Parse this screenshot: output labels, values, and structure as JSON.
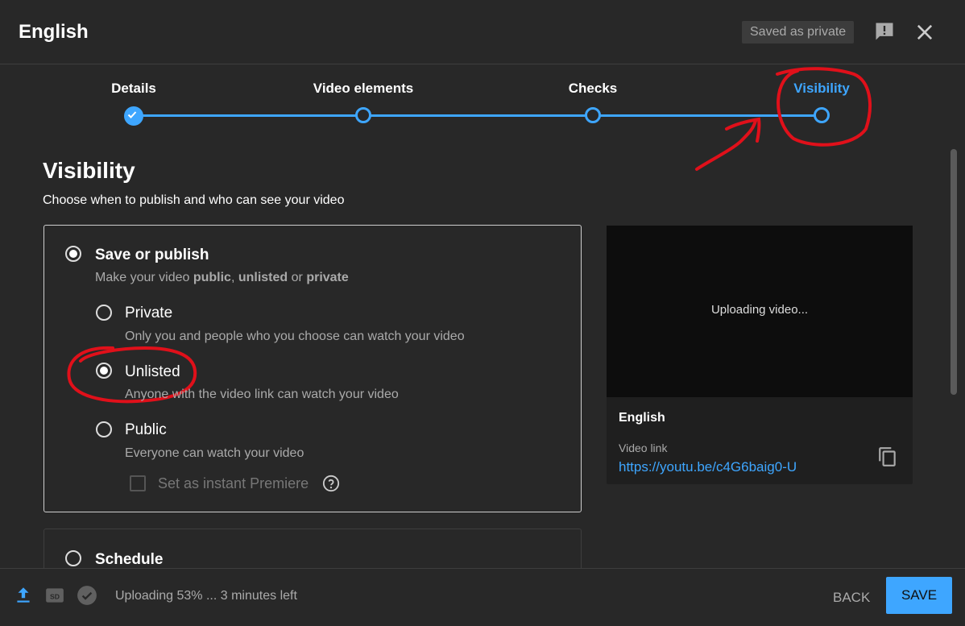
{
  "header": {
    "title": "English",
    "saved_badge": "Saved as private",
    "feedback_icon": "feedback-icon",
    "close_icon": "close-icon"
  },
  "stepper": {
    "steps": [
      {
        "label": "Details",
        "state": "done"
      },
      {
        "label": "Video elements",
        "state": "pending"
      },
      {
        "label": "Checks",
        "state": "pending"
      },
      {
        "label": "Visibility",
        "state": "current"
      }
    ],
    "accent": "#3ea6ff"
  },
  "visibility": {
    "title": "Visibility",
    "subtitle": "Choose when to publish and who can see your video",
    "save_or_publish": {
      "label": "Save or publish",
      "desc_prefix": "Make your video ",
      "desc_public": "public",
      "desc_sep1": ", ",
      "desc_unlisted": "unlisted",
      "desc_sep2": " or ",
      "desc_private": "private",
      "selected": true
    },
    "options": [
      {
        "label": "Private",
        "desc": "Only you and people who you choose can watch your video",
        "selected": false
      },
      {
        "label": "Unlisted",
        "desc": "Anyone with the video link can watch your video",
        "selected": true
      },
      {
        "label": "Public",
        "desc": "Everyone can watch your video",
        "selected": false
      }
    ],
    "premiere_label": "Set as instant Premiere",
    "schedule_label": "Schedule"
  },
  "preview": {
    "status": "Uploading video...",
    "title": "English",
    "link_label": "Video link",
    "link": "https://youtu.be/c4G6baig0-U"
  },
  "footer": {
    "status": "Uploading 53% ... 3 minutes left",
    "back_label": "BACK",
    "save_label": "SAVE",
    "icons": [
      "upload-icon",
      "sd-icon",
      "check-circle-icon"
    ]
  },
  "annotation_color": "#e0101a"
}
